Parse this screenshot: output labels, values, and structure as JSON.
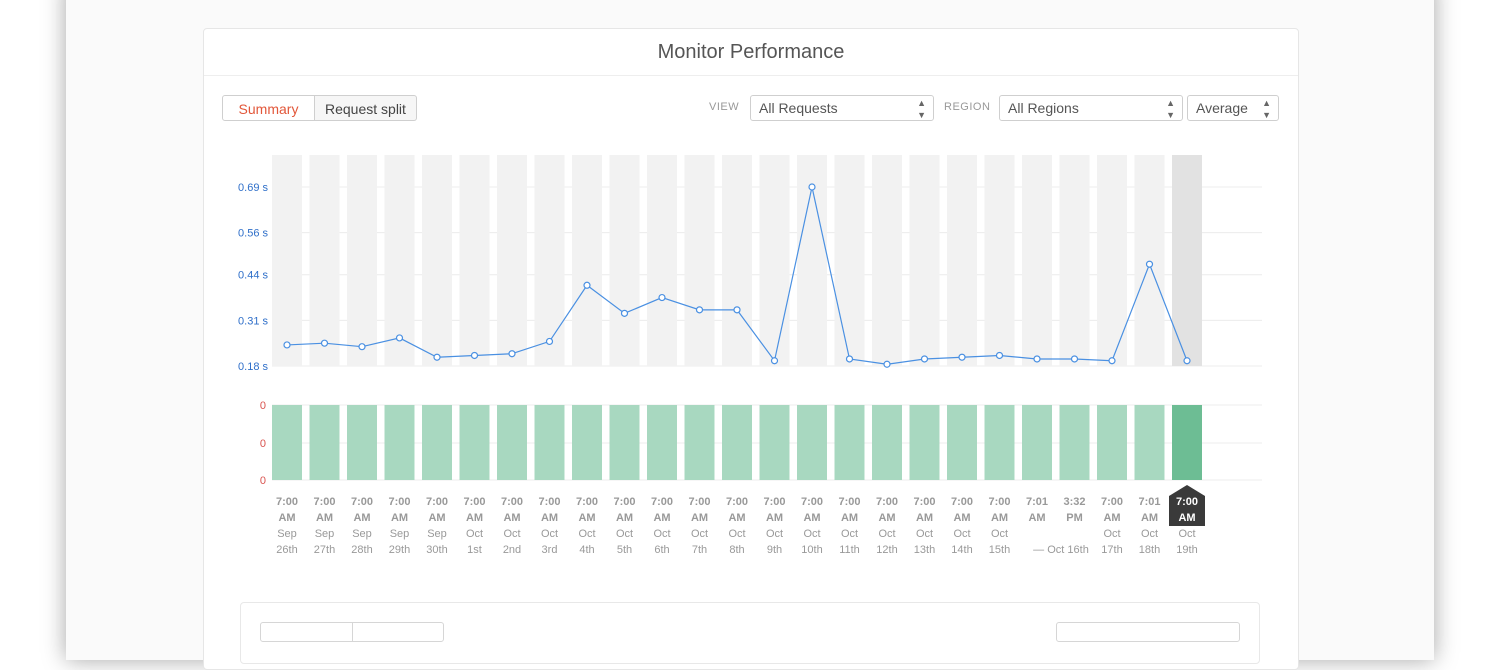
{
  "title": "Monitor Performance",
  "tabs": {
    "summary": "Summary",
    "request_split": "Request split"
  },
  "filters": {
    "view_label": "VIEW",
    "view_value": "All Requests",
    "region_label": "REGION",
    "region_value": "All Regions",
    "agg_value": "Average"
  },
  "colors": {
    "line": "#4a90e2",
    "response_axis": "#2f6fc9",
    "error_axis": "#d9534f",
    "bar": "#a8d8c0",
    "bar_selected": "#6dbd94",
    "band": "#f2f2f2",
    "band_selected": "#e2e2e2",
    "tooltip_bg": "#3a3a3a"
  },
  "chart_data": {
    "type": "line",
    "y_ticks": [
      "0.69 s",
      "0.56 s",
      "0.44 s",
      "0.31 s",
      "0.18 s"
    ],
    "error_ticks": [
      "0",
      "0",
      "0"
    ],
    "selected_index": 24,
    "points": [
      {
        "time": "7:00 AM",
        "date": "Sep 26th",
        "response": 0.24,
        "errors": 0
      },
      {
        "time": "7:00 AM",
        "date": "Sep 27th",
        "response": 0.245,
        "errors": 0
      },
      {
        "time": "7:00 AM",
        "date": "Sep 28th",
        "response": 0.235,
        "errors": 0
      },
      {
        "time": "7:00 AM",
        "date": "Sep 29th",
        "response": 0.26,
        "errors": 0
      },
      {
        "time": "7:00 AM",
        "date": "Sep 30th",
        "response": 0.205,
        "errors": 0
      },
      {
        "time": "7:00 AM",
        "date": "Oct 1st",
        "response": 0.21,
        "errors": 0
      },
      {
        "time": "7:00 AM",
        "date": "Oct 2nd",
        "response": 0.215,
        "errors": 0
      },
      {
        "time": "7:00 AM",
        "date": "Oct 3rd",
        "response": 0.25,
        "errors": 0
      },
      {
        "time": "7:00 AM",
        "date": "Oct 4th",
        "response": 0.41,
        "errors": 0
      },
      {
        "time": "7:00 AM",
        "date": "Oct 5th",
        "response": 0.33,
        "errors": 0
      },
      {
        "time": "7:00 AM",
        "date": "Oct 6th",
        "response": 0.375,
        "errors": 0
      },
      {
        "time": "7:00 AM",
        "date": "Oct 7th",
        "response": 0.34,
        "errors": 0
      },
      {
        "time": "7:00 AM",
        "date": "Oct 8th",
        "response": 0.34,
        "errors": 0
      },
      {
        "time": "7:00 AM",
        "date": "Oct 9th",
        "response": 0.195,
        "errors": 0
      },
      {
        "time": "7:00 AM",
        "date": "Oct 10th",
        "response": 0.69,
        "errors": 0
      },
      {
        "time": "7:00 AM",
        "date": "Oct 11th",
        "response": 0.2,
        "errors": 0
      },
      {
        "time": "7:00 AM",
        "date": "Oct 12th",
        "response": 0.185,
        "errors": 0
      },
      {
        "time": "7:00 AM",
        "date": "Oct 13th",
        "response": 0.2,
        "errors": 0
      },
      {
        "time": "7:00 AM",
        "date": "Oct 14th",
        "response": 0.205,
        "errors": 0
      },
      {
        "time": "7:00 AM",
        "date": "Oct 15th",
        "response": 0.21,
        "errors": 0
      },
      {
        "time": "7:01 AM",
        "date": "— Oct 16th",
        "response": 0.2,
        "errors": 0
      },
      {
        "time": "3:32 PM",
        "date": "",
        "response": 0.2,
        "errors": 0
      },
      {
        "time": "7:00 AM",
        "date": "Oct 17th",
        "response": 0.195,
        "errors": 0
      },
      {
        "time": "7:01 AM",
        "date": "Oct 18th",
        "response": 0.47,
        "errors": 0
      },
      {
        "time": "7:00 AM",
        "date": "Oct 19th",
        "response": 0.195,
        "errors": 0
      }
    ]
  }
}
